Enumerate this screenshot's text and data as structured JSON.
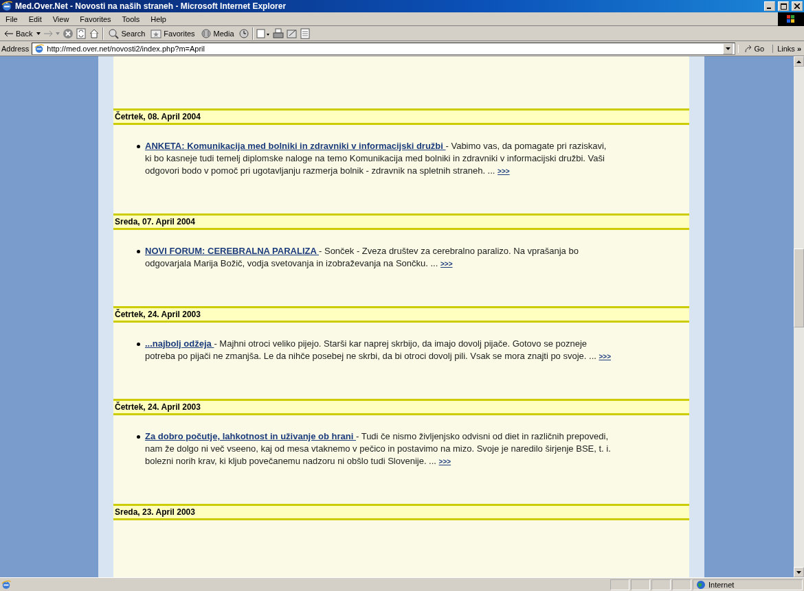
{
  "window": {
    "title": "Med.Over.Net - Novosti na naših straneh - Microsoft Internet Explorer"
  },
  "menu": [
    "File",
    "Edit",
    "View",
    "Favorites",
    "Tools",
    "Help"
  ],
  "toolbar": {
    "back": "Back",
    "search": "Search",
    "favorites": "Favorites",
    "media": "Media"
  },
  "address": {
    "label": "Address",
    "url": "http://med.over.net/novosti2/index.php?m=April",
    "go": "Go",
    "links": "Links",
    "links_more": "»"
  },
  "news": [
    {
      "date": "Četrtek, 08. April 2004",
      "title": "ANKETA: Komunikacija med bolniki in zdravniki v informacijski družbi ",
      "text": "- Vabimo vas, da pomagate pri raziskavi, ki bo kasneje tudi temelj diplomske naloge na temo Komunikacija med bolniki in zdravniki v informacijski družbi. Vaši odgovori bodo v pomoč pri ugotavljanju razmerja bolnik - zdravnik na spletnih straneh. ...",
      "more": ">>>"
    },
    {
      "date": "Sreda, 07. April 2004",
      "title": "NOVI FORUM: CEREBRALNA PARALIZA ",
      "text": "- Sonček - Zveza društev za cerebralno paralizo. Na vprašanja bo odgovarjala Marija Božič, vodja svetovanja in izobraževanja na Sončku. ...",
      "more": ">>>"
    },
    {
      "date": "Četrtek, 24. April 2003",
      "title": "...najbolj odžeja ",
      "text": "- Majhni otroci veliko pijejo. Starši kar naprej skrbijo, da imajo dovolj pijače. Gotovo se pozneje potreba po pijači ne zmanjša. Le da nihče posebej ne skrbi, da bi otroci dovolj pili. Vsak se mora znajti po svoje. ...",
      "more": ">>>"
    },
    {
      "date": "Četrtek, 24. April 2003",
      "title": "Za dobro počutje, lahkotnost in uživanje ob hrani ",
      "text": "- Tudi če nismo življenjsko odvisni od diet in različnih prepovedi, nam že dolgo ni več vseeno, kaj od mesa vtaknemo v pečico in postavimo na mizo. Svoje je naredilo širjenje BSE, t. i. bolezni norih krav, ki kljub povečanemu nadzoru ni obšlo tudi Slovenije. ...",
      "more": ">>>"
    },
    {
      "date": "Sreda, 23. April 2003"
    }
  ],
  "status": {
    "zone": "Internet"
  }
}
